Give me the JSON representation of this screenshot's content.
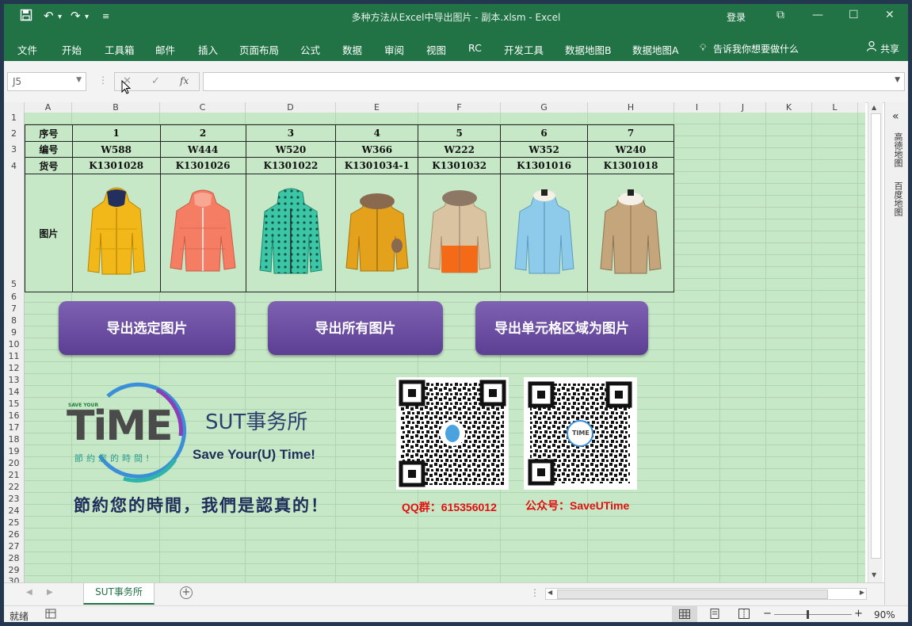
{
  "window": {
    "title": "多种方法从Excel中导出图片 - 副本.xlsm  -  Excel",
    "login": "登录"
  },
  "ribbon": {
    "tabs": [
      "文件",
      "开始",
      "工具箱",
      "邮件",
      "插入",
      "页面布局",
      "公式",
      "数据",
      "审阅",
      "视图",
      "RC",
      "开发工具",
      "数据地图B",
      "数据地图A"
    ],
    "tell_me": "告诉我你想要做什么",
    "share": "共享"
  },
  "formula_bar": {
    "name_box": "J5",
    "fx": "fx",
    "formula": ""
  },
  "columns": [
    "A",
    "B",
    "C",
    "D",
    "E",
    "F",
    "G",
    "H",
    "I",
    "J",
    "K",
    "L"
  ],
  "rows": [
    "1",
    "2",
    "3",
    "4",
    "5",
    "6",
    "7",
    "8",
    "9",
    "10",
    "11",
    "12",
    "13",
    "14",
    "15",
    "16",
    "17",
    "18",
    "19",
    "20",
    "21",
    "22",
    "23",
    "24",
    "25",
    "26",
    "27",
    "28",
    "29",
    "30"
  ],
  "table": {
    "row_labels": [
      "序号",
      "编号",
      "货号",
      "图片"
    ],
    "seq": [
      "1",
      "2",
      "3",
      "4",
      "5",
      "6",
      "7"
    ],
    "codes": [
      "W588",
      "W444",
      "W520",
      "W366",
      "W222",
      "W352",
      "W240"
    ],
    "items": [
      "K1301028",
      "K1301026",
      "K1301022",
      "K1301034-1",
      "K1301032",
      "K1301016",
      "K1301018"
    ]
  },
  "buttons": {
    "export_selected": "导出选定图片",
    "export_all": "导出所有图片",
    "export_range": "导出单元格区域为图片"
  },
  "branding": {
    "logo_top": "SAVE YOUR",
    "logo_main": "TiME",
    "logo_sub": "節約您的時間!",
    "name": "SUT事务所",
    "slogan": "Save Your(U) Time!",
    "motto": "節約您的時間，我們是認真的！",
    "qq": "QQ群：615356012",
    "wechat": "公众号：SaveUTime",
    "qr_logo": "TIME"
  },
  "task_pane": {
    "items": [
      "高德地图",
      "百度地图"
    ]
  },
  "sheet_tab": "SUT事务所",
  "status": {
    "ready": "就绪",
    "zoom": "90%"
  },
  "colors": {
    "excel_green": "#217346",
    "sheet_bg": "#c6e8c6",
    "button_purple": "#6a4ca2",
    "red": "#e01010",
    "navy": "#1f2d5a"
  }
}
